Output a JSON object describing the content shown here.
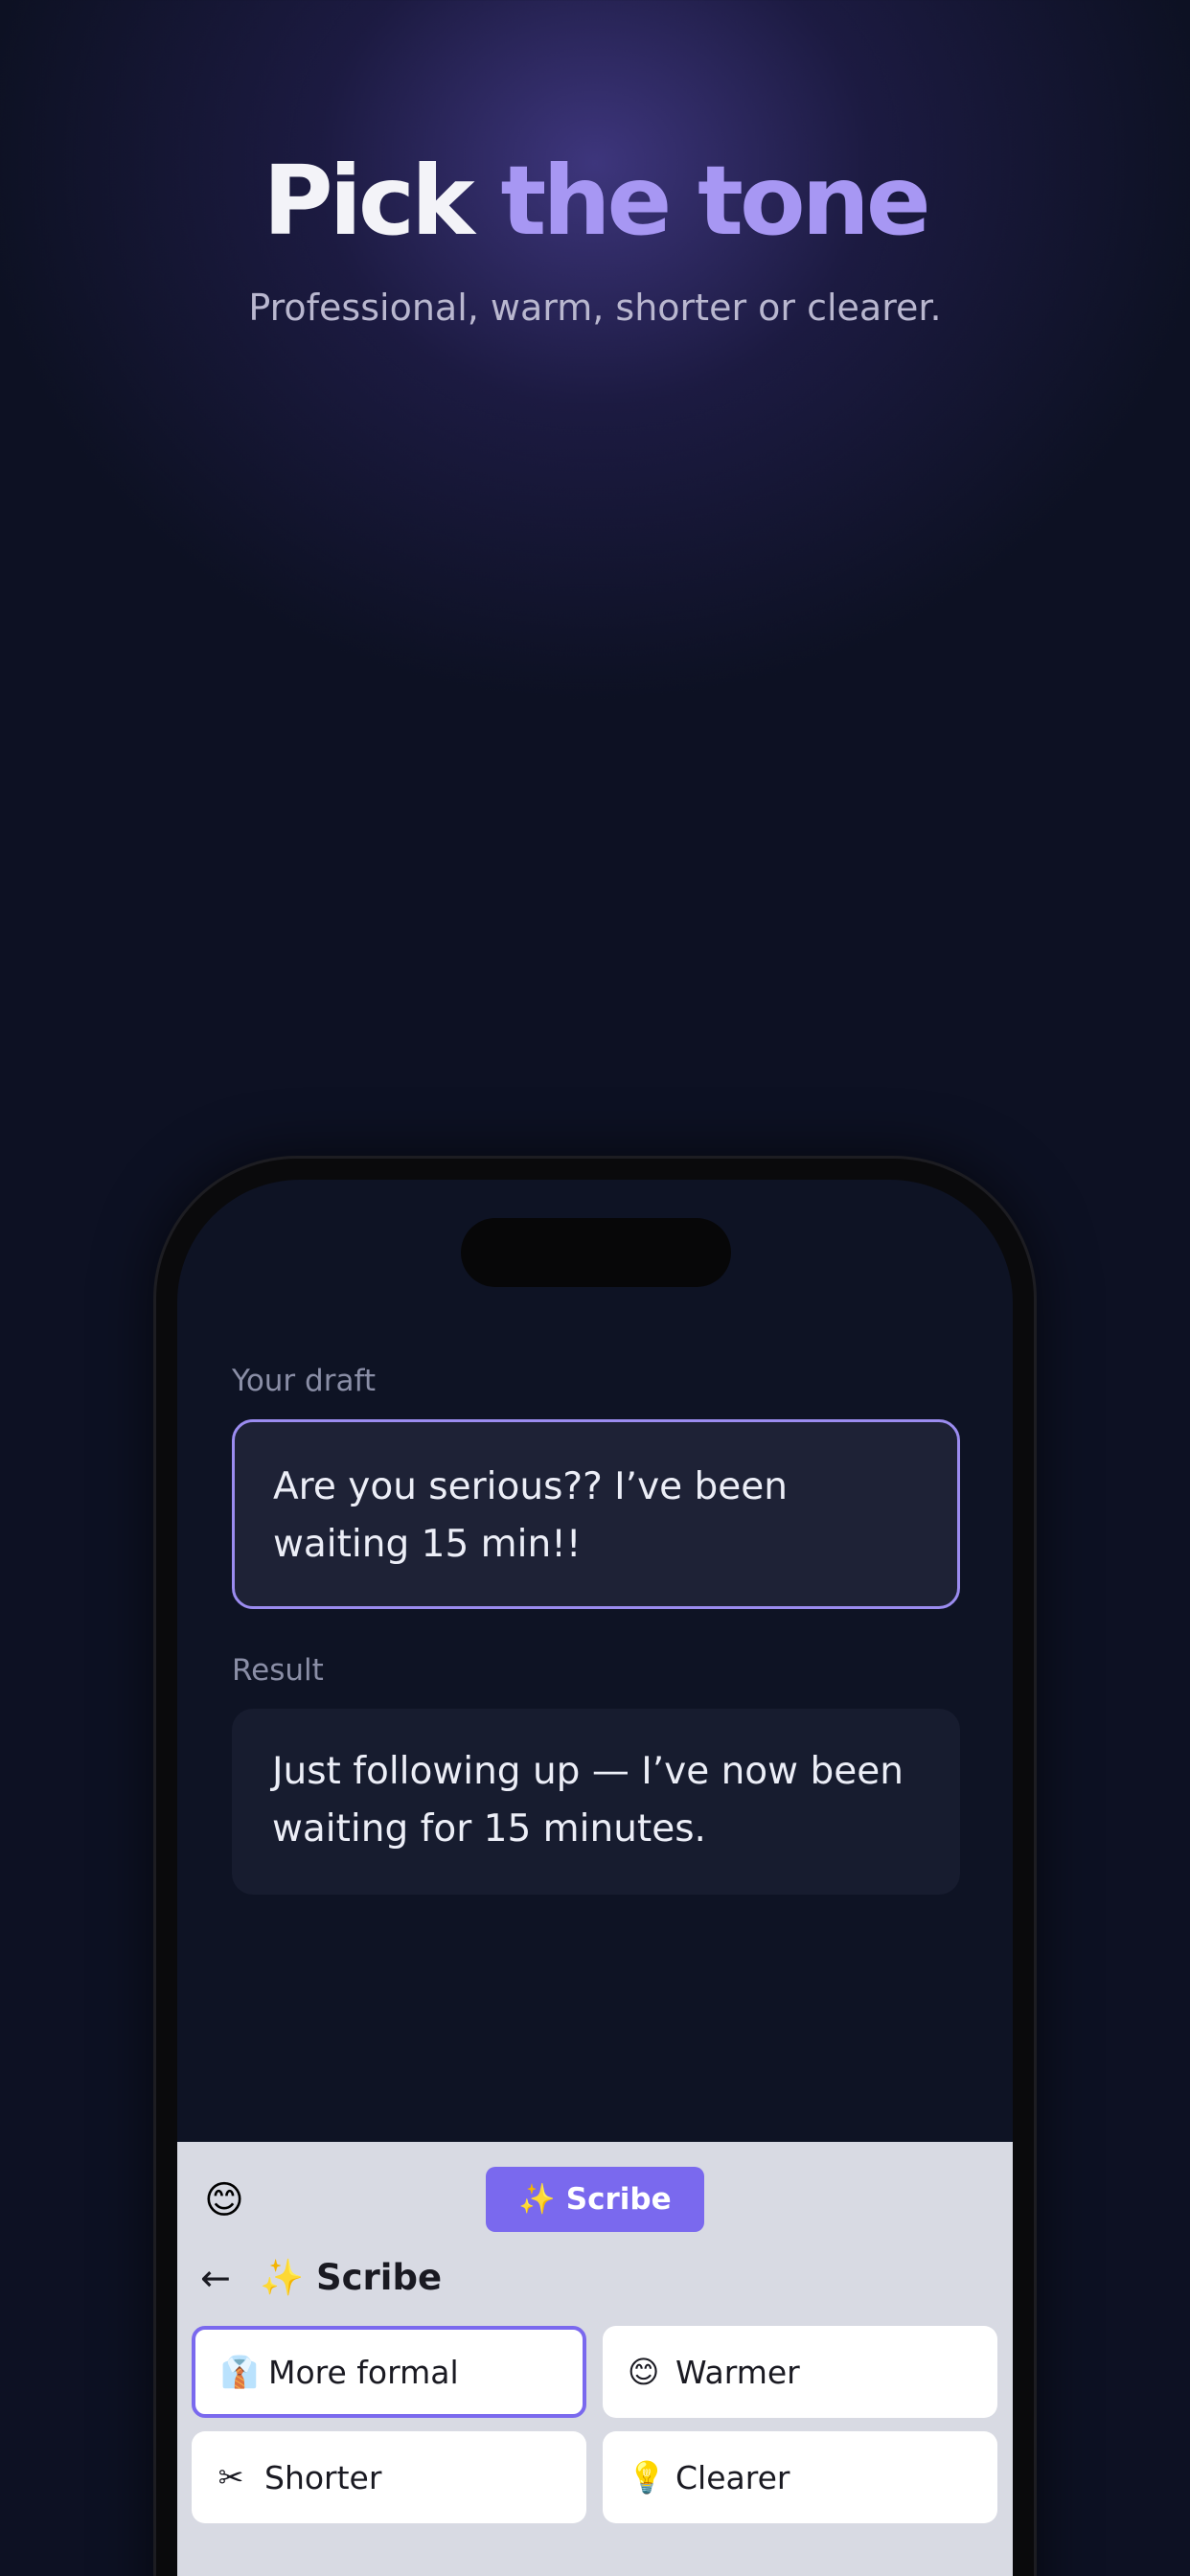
{
  "hero": {
    "title_part1": "Pick",
    "title_part2": "the tone",
    "subtitle": "Professional, warm, shorter or clearer."
  },
  "colors": {
    "accent": "#7a69ee",
    "accent_light": "#a797f3",
    "background": "#0d1123",
    "keyboard_bg": "#d8dae3"
  },
  "screen": {
    "draft_label": "Your draft",
    "draft_text": "Are you serious?? I’ve been waiting 15 min!!",
    "result_label": "Result",
    "result_text": "Just following up — I’ve now been waiting for 15 minutes."
  },
  "keyboard": {
    "emoji_icon": "😊",
    "scribe_button": "✨ Scribe",
    "back_icon": "←",
    "panel_title": "✨ Scribe",
    "tones": [
      {
        "icon": "👔",
        "label": "More formal",
        "selected": true
      },
      {
        "icon": "😊",
        "label": "Warmer",
        "selected": false
      },
      {
        "icon": "✂",
        "label": "Shorter",
        "selected": false
      },
      {
        "icon": "💡",
        "label": "Clearer",
        "selected": false
      }
    ]
  }
}
